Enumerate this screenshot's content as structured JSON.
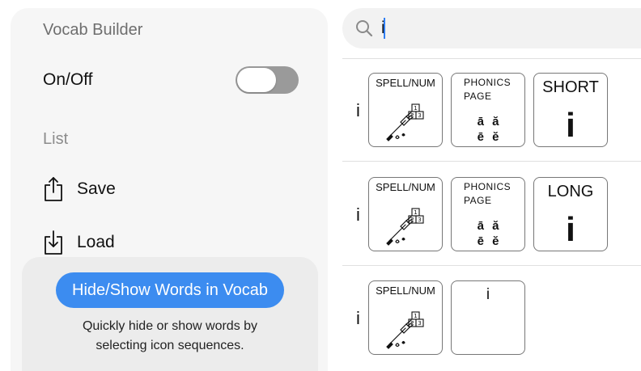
{
  "panel": {
    "title": "Vocab Builder",
    "onoff_label": "On/Off",
    "toggle_on": false,
    "list_label": "List",
    "save_label": "Save",
    "load_label": "Load",
    "icons": {
      "save": "share-upload-icon",
      "load": "download-icon"
    }
  },
  "tip": {
    "button_label": "Hide/Show Words in Vocab",
    "description_line1": "Quickly hide or show words by",
    "description_line2": "selecting icon sequences."
  },
  "search": {
    "value": "i",
    "icon": "search-icon"
  },
  "colors": {
    "accent": "#3c8cf0",
    "panel_bg": "#f6f6f6",
    "tip_bg": "#ececec",
    "toggle_off": "#9a9a9a"
  },
  "results": [
    {
      "word": "i",
      "cells": [
        {
          "type": "spell",
          "label": "SPELL/NUM",
          "icon": "paintbrush-blocks-icon"
        },
        {
          "type": "phonics",
          "line1": "PHONICS",
          "line2": "PAGE",
          "vowels1": "ā ă",
          "vowels2": "ē ĕ"
        },
        {
          "type": "big",
          "label": "SHORT",
          "symbol": "i"
        }
      ]
    },
    {
      "word": "i",
      "cells": [
        {
          "type": "spell",
          "label": "SPELL/NUM",
          "icon": "paintbrush-blocks-icon"
        },
        {
          "type": "phonics",
          "line1": "PHONICS",
          "line2": "PAGE",
          "vowels1": "ā ă",
          "vowels2": "ē ĕ"
        },
        {
          "type": "big",
          "label": "LONG",
          "symbol": "i"
        }
      ]
    },
    {
      "word": "i",
      "cells": [
        {
          "type": "spell",
          "label": "SPELL/NUM",
          "icon": "paintbrush-blocks-icon"
        },
        {
          "type": "letter",
          "label": "i"
        }
      ]
    }
  ]
}
